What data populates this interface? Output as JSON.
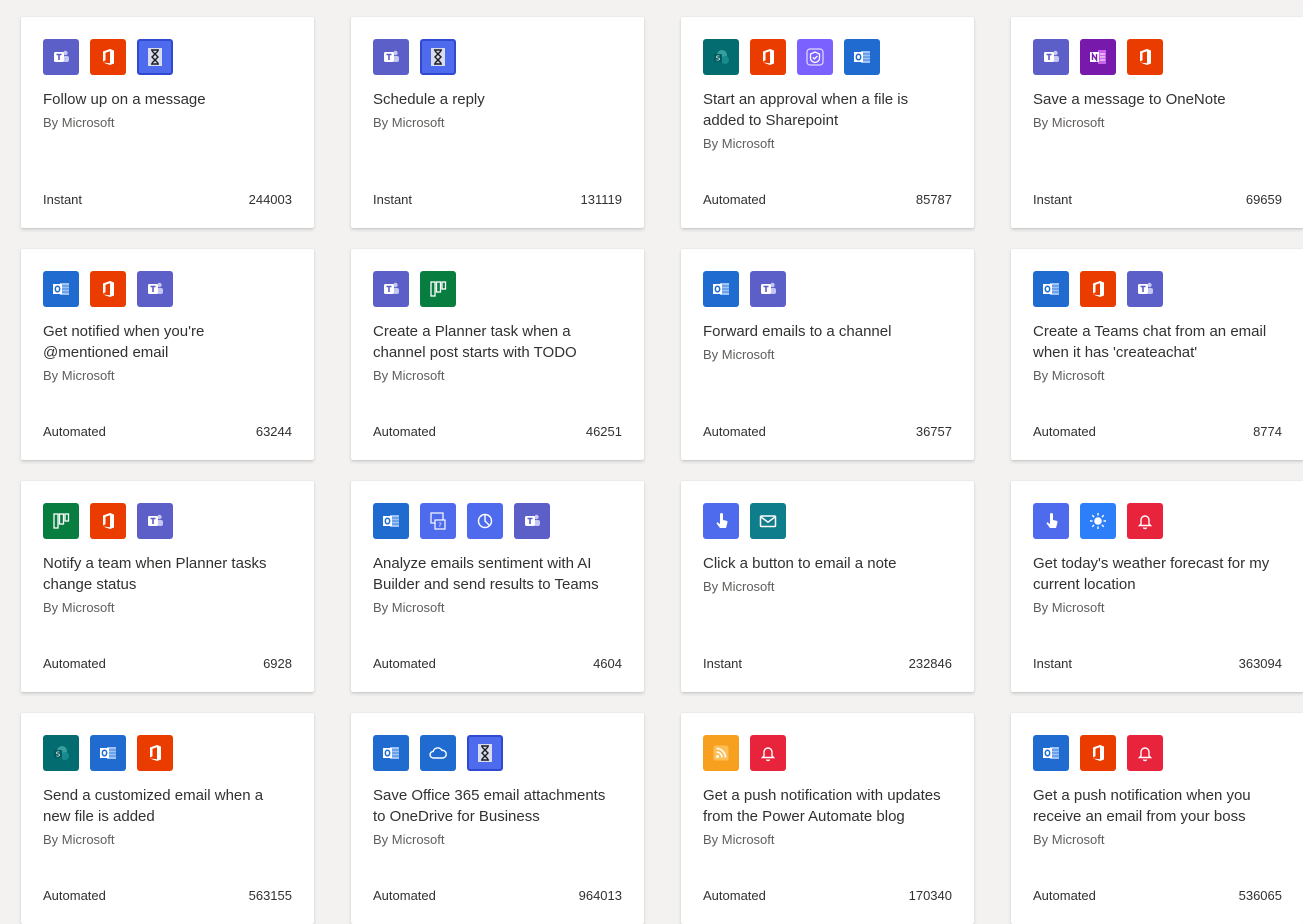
{
  "colors": {
    "teams": "#5b5fc7",
    "office": "#eb3c00",
    "delay": "#4f6bed",
    "outlook": "#1f6bd0",
    "sharepoint": "#036c70",
    "approvals": "#7b61ff",
    "onenote": "#7719aa",
    "planner": "#077d3f",
    "ai_builder": "#4f6bed",
    "button": "#4f6bed",
    "mail": "#0f7d8c",
    "weather": "#2d7ff9",
    "notification": "#e8243c",
    "rss": "#f7a01f",
    "onedrive": "#1f6bd0"
  },
  "cards": [
    {
      "title": "Follow up on a message",
      "author": "By Microsoft",
      "type": "Instant",
      "count": "244003",
      "icons": [
        "teams-icon",
        "office-icon",
        "delay-icon"
      ]
    },
    {
      "title": "Schedule a reply",
      "author": "By Microsoft",
      "type": "Instant",
      "count": "131119",
      "icons": [
        "teams-icon",
        "delay-icon"
      ]
    },
    {
      "title": "Start an approval when a file is added to Sharepoint",
      "author": "By Microsoft",
      "type": "Automated",
      "count": "85787",
      "icons": [
        "sharepoint-icon",
        "office-icon",
        "approvals-icon",
        "outlook-icon"
      ]
    },
    {
      "title": "Save a message to OneNote",
      "author": "By Microsoft",
      "type": "Instant",
      "count": "69659",
      "icons": [
        "teams-icon",
        "onenote-icon",
        "office-icon"
      ]
    },
    {
      "title": "Get notified when you're @mentioned email",
      "author": "By Microsoft",
      "type": "Automated",
      "count": "63244",
      "icons": [
        "outlook-icon",
        "office-icon",
        "teams-icon"
      ]
    },
    {
      "title": "Create a Planner task when a channel post starts with TODO",
      "author": "By Microsoft",
      "type": "Automated",
      "count": "46251",
      "icons": [
        "teams-icon",
        "planner-icon"
      ]
    },
    {
      "title": "Forward emails to a channel",
      "author": "By Microsoft",
      "type": "Automated",
      "count": "36757",
      "icons": [
        "outlook-icon",
        "teams-icon"
      ]
    },
    {
      "title": "Create a Teams chat from an email when it has 'createachat'",
      "author": "By Microsoft",
      "type": "Automated",
      "count": "8774",
      "icons": [
        "outlook-icon",
        "office-icon",
        "teams-icon"
      ]
    },
    {
      "title": "Notify a team when Planner tasks change status",
      "author": "By Microsoft",
      "type": "Automated",
      "count": "6928",
      "icons": [
        "planner-icon",
        "office-icon",
        "teams-icon"
      ]
    },
    {
      "title": "Analyze emails sentiment with AI Builder and send results to Teams",
      "author": "By Microsoft",
      "type": "Automated",
      "count": "4604",
      "icons": [
        "outlook-icon",
        "ai-builder-icon",
        "sentiment-icon",
        "teams-icon"
      ]
    },
    {
      "title": "Click a button to email a note",
      "author": "By Microsoft",
      "type": "Instant",
      "count": "232846",
      "icons": [
        "button-icon",
        "mail-icon"
      ]
    },
    {
      "title": "Get today's weather forecast for my current location",
      "author": "By Microsoft",
      "type": "Instant",
      "count": "363094",
      "icons": [
        "button-icon",
        "weather-icon",
        "notification-icon"
      ]
    },
    {
      "title": "Send a customized email when a new file is added",
      "author": "By Microsoft",
      "type": "Automated",
      "count": "563155",
      "icons": [
        "sharepoint-icon",
        "outlook-icon",
        "office-icon"
      ]
    },
    {
      "title": "Save Office 365 email attachments to OneDrive for Business",
      "author": "By Microsoft",
      "type": "Automated",
      "count": "964013",
      "icons": [
        "outlook-icon",
        "onedrive-icon",
        "delay-icon"
      ]
    },
    {
      "title": "Get a push notification with updates from the Power Automate blog",
      "author": "By Microsoft",
      "type": "Automated",
      "count": "170340",
      "icons": [
        "rss-icon",
        "notification-icon"
      ]
    },
    {
      "title": "Get a push notification when you receive an email from your boss",
      "author": "By Microsoft",
      "type": "Automated",
      "count": "536065",
      "icons": [
        "outlook-icon",
        "office-icon",
        "notification-icon"
      ]
    }
  ]
}
